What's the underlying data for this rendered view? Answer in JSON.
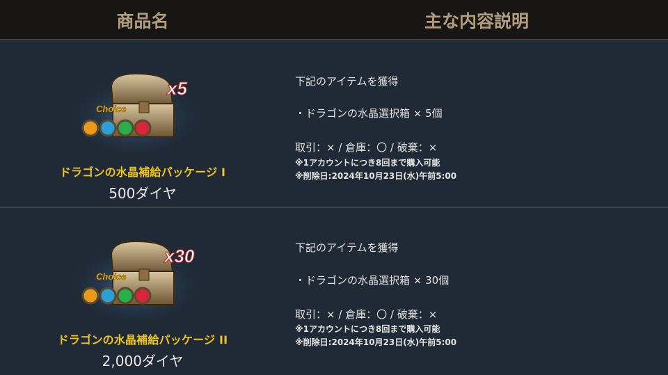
{
  "header": {
    "product_col": "商品名",
    "desc_col": "主な内容説明"
  },
  "products": [
    {
      "name": "ドラゴンの水晶補給パッケージ I",
      "price": "500ダイヤ",
      "badge_multiplier": "x5",
      "badge_label": "Choice",
      "desc": {
        "intro": "下記のアイテムを獲得",
        "item": "・ドラゴンの水晶選択箱 × 5個",
        "trade": "取引：× / 倉庫：〇 / 破棄：×",
        "limit": "※1アカウントにつき8回まで購入可能",
        "removal": "※削除日:2024年10月23日(水)午前5:00"
      }
    },
    {
      "name": "ドラゴンの水晶補給パッケージ II",
      "price": "2,000ダイヤ",
      "badge_multiplier": "x30",
      "badge_label": "Choice",
      "desc": {
        "intro": "下記のアイテムを獲得",
        "item": "・ドラゴンの水晶選択箱 × 30個",
        "trade": "取引：× / 倉庫：〇 / 破棄：×",
        "limit": "※1アカウントにつき8回まで購入可能",
        "removal": "※削除日:2024年10月23日(水)午前5:00"
      }
    }
  ],
  "colors": {
    "background": "#1f2a36",
    "header_bg": "#171615",
    "header_text": "#b29d7e",
    "product_name": "#f0c419",
    "choice_badge": "#f0c419",
    "orb_colors": [
      "#e89a18",
      "#2a9fd8",
      "#27b04a",
      "#d8253a"
    ]
  }
}
